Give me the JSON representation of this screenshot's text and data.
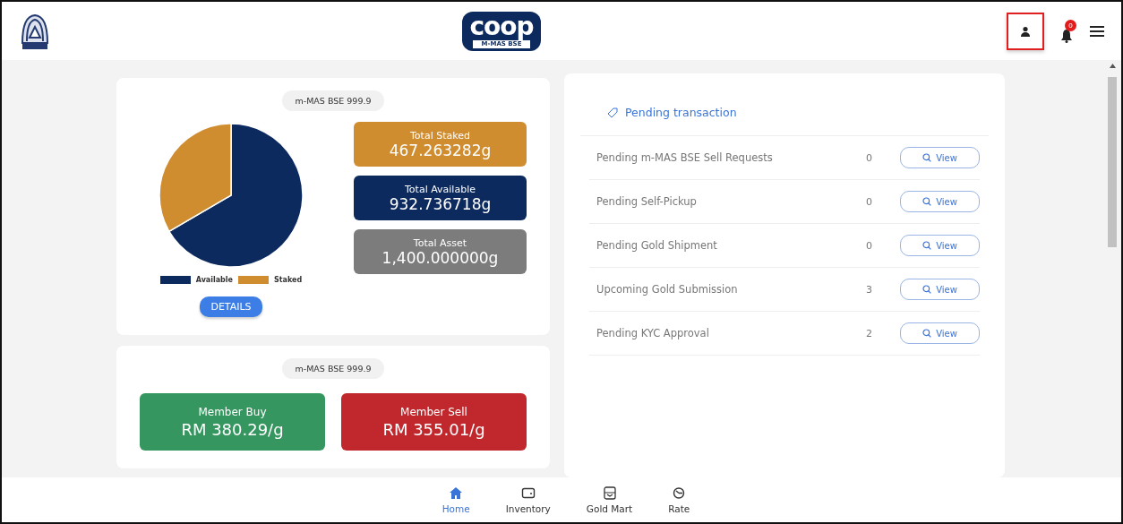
{
  "header": {
    "logo_text": "coop",
    "logo_subtext": "M-MAS BSE",
    "profile": {
      "highlighted": true
    },
    "notifications": {
      "count": "0"
    }
  },
  "holdings": {
    "product": "m-MAS BSE 999.9",
    "chart_data": {
      "type": "pie",
      "categories": [
        "Available",
        "Staked"
      ],
      "values": [
        66.6,
        33.4
      ],
      "colors": [
        "#0c2a5e",
        "#d08d30"
      ]
    },
    "details_button": "DETAILS",
    "totals": [
      {
        "label": "Total Staked",
        "value": "467.263282g",
        "color": "#d08d30"
      },
      {
        "label": "Total Available",
        "value": "932.736718g",
        "color": "#0c2a5e"
      },
      {
        "label": "Total Asset",
        "value": "1,400.000000g",
        "color": "#7c7c7c"
      }
    ]
  },
  "prices": {
    "product": "m-MAS BSE 999.9",
    "items": [
      {
        "label": "Member Buy",
        "value": "RM 380.29/g",
        "color": "#369660"
      },
      {
        "label": "Member Sell",
        "value": "RM 355.01/g",
        "color": "#c1282d"
      }
    ]
  },
  "pending": {
    "title": "Pending transaction",
    "rows": [
      {
        "label": "Pending m-MAS BSE Sell Requests",
        "count": "0",
        "action": "View"
      },
      {
        "label": "Pending Self-Pickup",
        "count": "0",
        "action": "View"
      },
      {
        "label": "Pending Gold Shipment",
        "count": "0",
        "action": "View"
      },
      {
        "label": "Upcoming Gold Submission",
        "count": "3",
        "action": "View"
      },
      {
        "label": "Pending KYC Approval",
        "count": "2",
        "action": "View"
      }
    ]
  },
  "bottom_nav": [
    {
      "kind": "home",
      "label": "Home",
      "selected": true
    },
    {
      "kind": "wallet",
      "label": "Inventory",
      "selected": false
    },
    {
      "kind": "mart",
      "label": "Gold Mart",
      "selected": false
    },
    {
      "kind": "rate",
      "label": "Rate",
      "selected": false
    }
  ]
}
